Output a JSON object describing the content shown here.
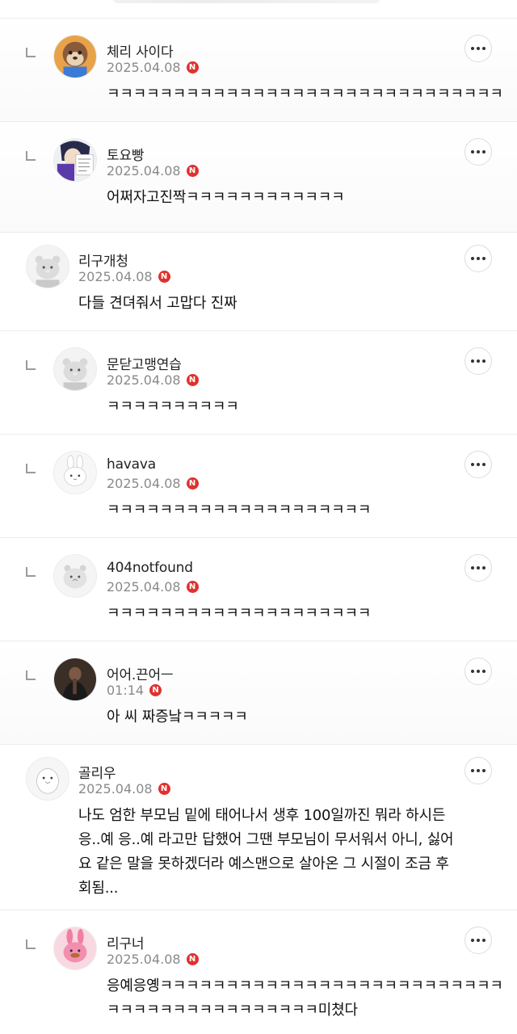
{
  "comments": [
    {
      "name": "체리 사이다",
      "date": "2025.04.08",
      "badge": "N",
      "text": "ㅋㅋㅋㅋㅋㅋㅋㅋㅋㅋㅋㅋㅋㅋㅋㅋㅋㅋㅋㅋㅋㅋㅋㅋㅋㅋㅋㅋㅋㅋ",
      "reply": true,
      "avatar": "raccoon-character-avatar"
    },
    {
      "name": "토요빵",
      "date": "2025.04.08",
      "badge": "N",
      "text": "어쩌자고진짝ㅋㅋㅋㅋㅋㅋㅋㅋㅋㅋㅋㅋ",
      "reply": true,
      "avatar": "anime-character-avatar"
    },
    {
      "name": "리구개청",
      "date": "2025.04.08",
      "badge": "N",
      "text": "다들 견뎌줘서 고맙다 진짜",
      "reply": false,
      "avatar": "gray-animal-avatar"
    },
    {
      "name": "문닫고맹연습",
      "date": "2025.04.08",
      "badge": "N",
      "text": "ㅋㅋㅋㅋㅋㅋㅋㅋㅋㅋ",
      "reply": true,
      "avatar": "gray-animal-avatar"
    },
    {
      "name": "havava",
      "date": "2025.04.08",
      "badge": "N",
      "text": "ㅋㅋㅋㅋㅋㅋㅋㅋㅋㅋㅋㅋㅋㅋㅋㅋㅋㅋㅋㅋ",
      "reply": true,
      "avatar": "rabbit-avatar"
    },
    {
      "name": "404notfound",
      "date": "2025.04.08",
      "badge": "N",
      "text": "ㅋㅋㅋㅋㅋㅋㅋㅋㅋㅋㅋㅋㅋㅋㅋㅋㅋㅋㅋㅋ",
      "reply": true,
      "avatar": "hamster-avatar"
    },
    {
      "name": "어어.끈어ㅡ",
      "date": "01:14",
      "badge": "N",
      "text": "아 씨 짜증낰ㅋㅋㅋㅋㅋ",
      "reply": true,
      "avatar": "dark-photo-avatar"
    },
    {
      "name": "골리우",
      "date": "2025.04.08",
      "badge": "N",
      "text": "나도 엄한 부모님 밑에 태어나서 생후 100일까진 뭐라 하시든\n응..예 응..예 라고만 답했어 그땐 부모님이 무서워서 아니, 싫어\n요 같은 말을 못하겠더라 예스맨으로 살아온 그 시절이 조금 후\n회됨...",
      "reply": false,
      "avatar": "penguin-avatar"
    },
    {
      "name": "리구너",
      "date": "2025.04.08",
      "badge": "N",
      "text": "응예응옝ㅋㅋㅋㅋㅋㅋㅋㅋㅋㅋㅋㅋㅋㅋㅋㅋㅋㅋㅋㅋㅋㅋㅋㅋㅋㅋ\nㅋㅋㅋㅋㅋㅋㅋㅋㅋㅋㅋㅋㅋㅋㅋㅋ미쳤다",
      "reply": true,
      "avatar": "pink-rabbit-avatar"
    }
  ],
  "colors": {
    "badge": "#e0312e",
    "meta": "#8a8a8a",
    "divider": "#ececec"
  },
  "more_icon": "more-dots-icon"
}
